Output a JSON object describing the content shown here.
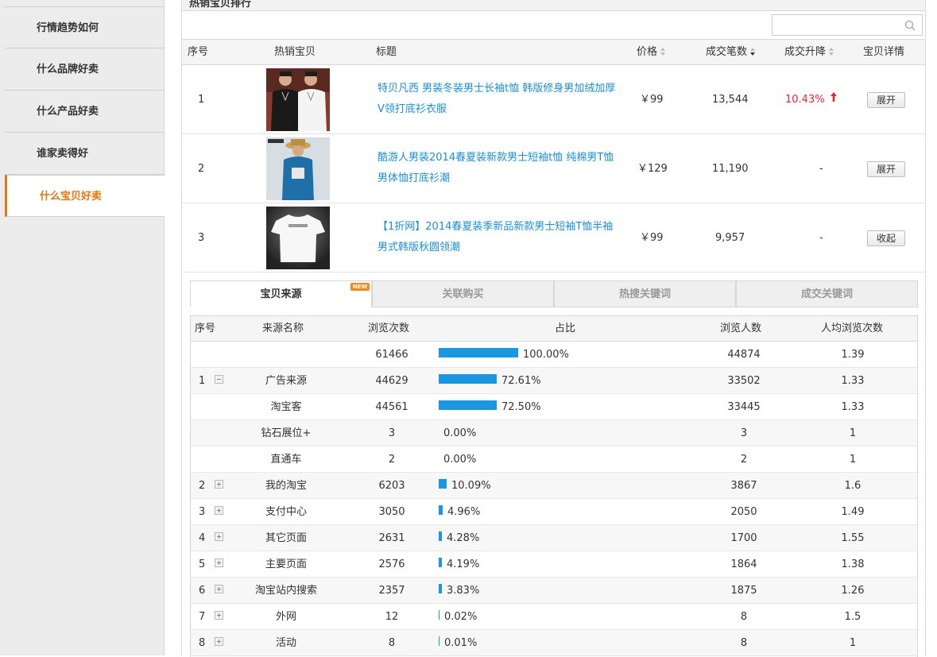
{
  "sidebar": {
    "items": [
      {
        "label": "行情趋势如何"
      },
      {
        "label": "什么品牌好卖"
      },
      {
        "label": "什么产品好卖"
      },
      {
        "label": "谁家卖得好"
      },
      {
        "label": "什么宝贝好卖",
        "active": true
      }
    ]
  },
  "panel": {
    "title": "热销宝贝排行",
    "search_value": "",
    "columns": [
      "序号",
      "热销宝贝",
      "标题",
      "价格",
      "成交笔数",
      "成交升降",
      "宝贝详情"
    ]
  },
  "products": [
    {
      "rank": "1",
      "title": "特贝凡西 男装冬装男士长袖t恤 韩版修身男加绒加厚V领打底衫衣服",
      "price": "￥99",
      "deals": "13,544",
      "change": "10.43%",
      "change_dir": "up",
      "button": "展开"
    },
    {
      "rank": "2",
      "title": "酷游人男装2014春夏装新款男士短袖t恤 纯棉男T恤男体恤打底衫潮",
      "price": "￥129",
      "deals": "11,190",
      "change": "-",
      "change_dir": "none",
      "button": "展开"
    },
    {
      "rank": "3",
      "title": "【1折网】2014春夏装季新品新款男士短袖T恤半袖男式韩版秋圆领潮",
      "price": "￥99",
      "deals": "9,957",
      "change": "-",
      "change_dir": "none",
      "button": "收起"
    }
  ],
  "tabs": [
    {
      "label": "宝贝来源",
      "active": true,
      "badge": "NEW"
    },
    {
      "label": "关联购买"
    },
    {
      "label": "热搜关键词"
    },
    {
      "label": "成交关键词"
    }
  ],
  "source_table": {
    "columns": [
      "序号",
      "来源名称",
      "浏览次数",
      "占比",
      "浏览人数",
      "人均浏览次数"
    ],
    "rows": [
      {
        "idx": "",
        "name": "",
        "views": "61466",
        "share": "100.00%",
        "share_value": 100.0,
        "visitors": "44874",
        "avg": "1.39",
        "toggle": "none"
      },
      {
        "idx": "1",
        "name": "广告来源",
        "views": "44629",
        "share": "72.61%",
        "share_value": 72.61,
        "visitors": "33502",
        "avg": "1.33",
        "toggle": "minus"
      },
      {
        "idx": "",
        "name": "淘宝客",
        "views": "44561",
        "share": "72.50%",
        "share_value": 72.5,
        "visitors": "33445",
        "avg": "1.33",
        "toggle": "none"
      },
      {
        "idx": "",
        "name": "钻石展位+",
        "views": "3",
        "share": "0.00%",
        "share_value": 0.0,
        "visitors": "3",
        "avg": "1",
        "toggle": "none"
      },
      {
        "idx": "",
        "name": "直通车",
        "views": "2",
        "share": "0.00%",
        "share_value": 0.0,
        "visitors": "2",
        "avg": "1",
        "toggle": "none"
      },
      {
        "idx": "2",
        "name": "我的淘宝",
        "views": "6203",
        "share": "10.09%",
        "share_value": 10.09,
        "visitors": "3867",
        "avg": "1.6",
        "toggle": "plus"
      },
      {
        "idx": "3",
        "name": "支付中心",
        "views": "3050",
        "share": "4.96%",
        "share_value": 4.96,
        "visitors": "2050",
        "avg": "1.49",
        "toggle": "plus"
      },
      {
        "idx": "4",
        "name": "其它页面",
        "views": "2631",
        "share": "4.28%",
        "share_value": 4.28,
        "visitors": "1700",
        "avg": "1.55",
        "toggle": "plus"
      },
      {
        "idx": "5",
        "name": "主要页面",
        "views": "2576",
        "share": "4.19%",
        "share_value": 4.19,
        "visitors": "1864",
        "avg": "1.38",
        "toggle": "plus"
      },
      {
        "idx": "6",
        "name": "淘宝站内搜索",
        "views": "2357",
        "share": "3.83%",
        "share_value": 3.83,
        "visitors": "1875",
        "avg": "1.26",
        "toggle": "plus"
      },
      {
        "idx": "7",
        "name": "外网",
        "views": "12",
        "share": "0.02%",
        "share_value": 0.02,
        "visitors": "8",
        "avg": "1.5",
        "toggle": "plus"
      },
      {
        "idx": "8",
        "name": "活动",
        "views": "8",
        "share": "0.01%",
        "share_value": 0.01,
        "visitors": "8",
        "avg": "1",
        "toggle": "plus"
      }
    ]
  },
  "colors": {
    "accent": "#e8740d",
    "link": "#1a8fd3",
    "bar": "#1a97e0",
    "up": "#e3262f"
  }
}
